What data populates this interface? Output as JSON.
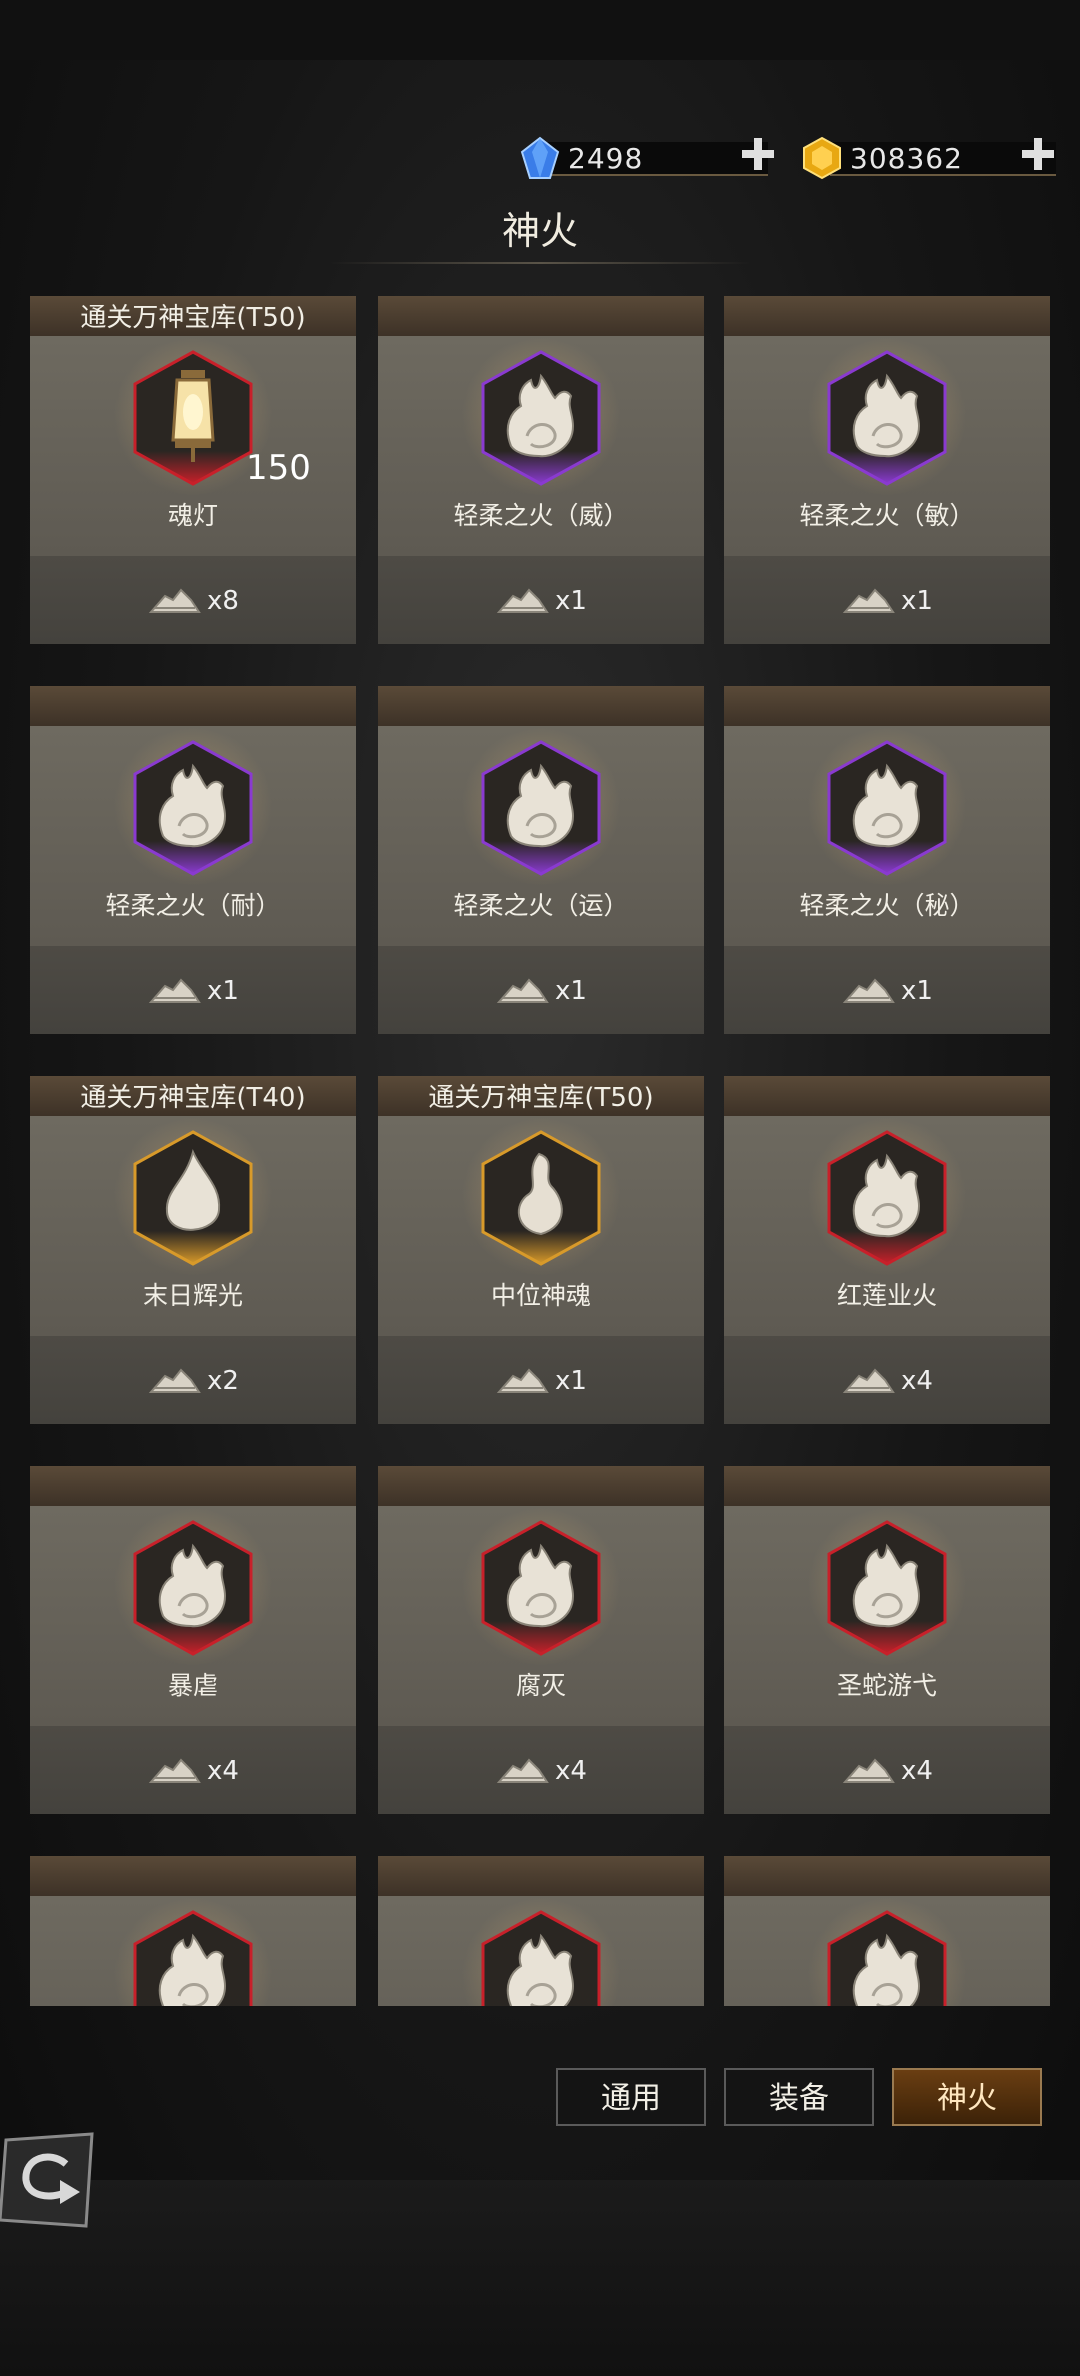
{
  "currencies": {
    "diamond": {
      "value": "2498",
      "icon": "blue-diamond-icon"
    },
    "gold": {
      "value": "308362",
      "icon": "gold-gem-icon"
    }
  },
  "title": "神火",
  "cards": [
    {
      "tab": "通关万神宝库(T50)",
      "name": "魂灯",
      "badge": "150",
      "cost": "x8",
      "frame": "#c8202a",
      "icon": "lantern-icon"
    },
    {
      "tab": "",
      "name": "轻柔之火（威）",
      "cost": "x1",
      "frame": "#8a3ad0",
      "icon": "flame-icon"
    },
    {
      "tab": "",
      "name": "轻柔之火（敏）",
      "cost": "x1",
      "frame": "#8a3ad0",
      "icon": "flame-icon"
    },
    {
      "tab": "",
      "name": "轻柔之火（耐）",
      "cost": "x1",
      "frame": "#8a3ad0",
      "icon": "flame-icon"
    },
    {
      "tab": "",
      "name": "轻柔之火（运）",
      "cost": "x1",
      "frame": "#8a3ad0",
      "icon": "flame-icon"
    },
    {
      "tab": "",
      "name": "轻柔之火（秘）",
      "cost": "x1",
      "frame": "#8a3ad0",
      "icon": "flame-icon"
    },
    {
      "tab": "通关万神宝库(T40)",
      "name": "末日辉光",
      "cost": "x2",
      "frame": "#d89a2a",
      "icon": "ember-icon"
    },
    {
      "tab": "通关万神宝库(T50)",
      "name": "中位神魂",
      "cost": "x1",
      "frame": "#d89a2a",
      "icon": "soul-icon"
    },
    {
      "tab": "",
      "name": "红莲业火",
      "cost": "x4",
      "frame": "#c8202a",
      "icon": "flame-icon"
    },
    {
      "tab": "",
      "name": "暴虐",
      "cost": "x4",
      "frame": "#c8202a",
      "icon": "flame-icon"
    },
    {
      "tab": "",
      "name": "腐灭",
      "cost": "x4",
      "frame": "#c8202a",
      "icon": "flame-icon"
    },
    {
      "tab": "",
      "name": "圣蛇游弋",
      "cost": "x4",
      "frame": "#c8202a",
      "icon": "flame-icon"
    },
    {
      "tab": "",
      "name": "",
      "cost": "",
      "frame": "#c8202a",
      "icon": "flame-icon"
    },
    {
      "tab": "",
      "name": "",
      "cost": "",
      "frame": "#c8202a",
      "icon": "flame-icon"
    },
    {
      "tab": "",
      "name": "",
      "cost": "",
      "frame": "#c8202a",
      "icon": "flame-icon"
    }
  ],
  "cost_icon": "crystal-pile-icon",
  "tabs": [
    {
      "label": "通用",
      "active": false
    },
    {
      "label": "装备",
      "active": false
    },
    {
      "label": "神火",
      "active": true
    }
  ],
  "back_icon": "back-arrow-icon"
}
